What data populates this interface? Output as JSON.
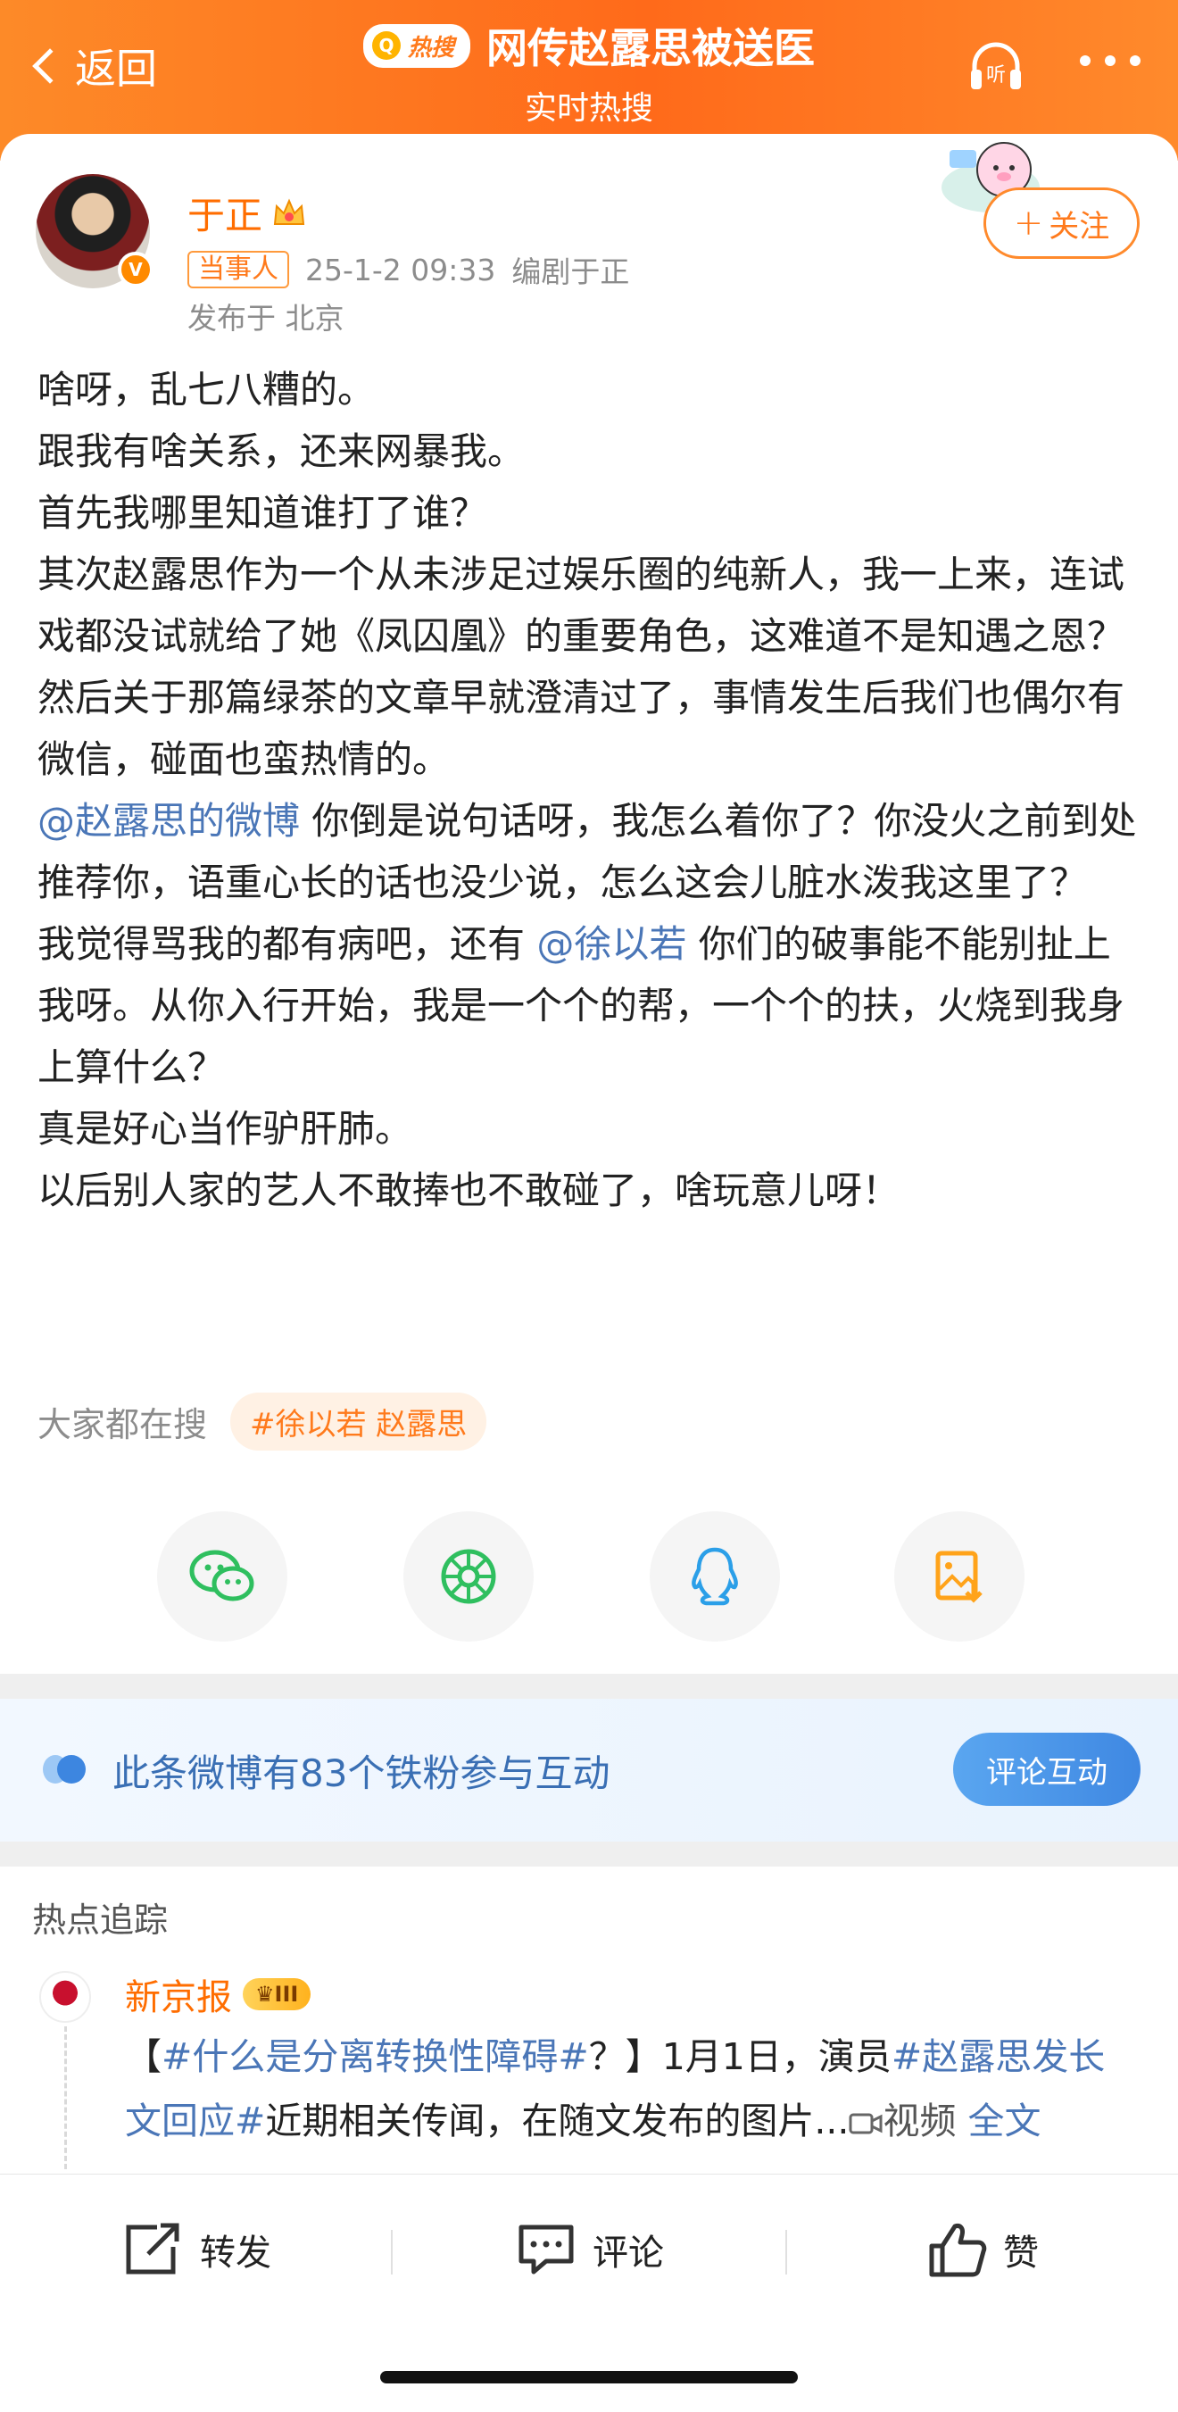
{
  "header": {
    "back_label": "返回",
    "hot_badge": "热搜",
    "title": "网传赵露思被送医",
    "subtitle": "实时热搜",
    "listen_label": "听",
    "bg_color": "#ff7a22"
  },
  "post": {
    "author": "于正",
    "role_tag": "当事人",
    "timestamp": "25-1-2 09:33",
    "author_desc": "编剧于正",
    "location": "发布于 北京",
    "follow_label": "关注",
    "lines": [
      "啥呀，乱七八糟的。",
      "跟我有啥关系，还来网暴我。",
      "首先我哪里知道谁打了谁？",
      "其次赵露思作为一个从未涉足过娱乐圈的纯新人，我一上来，连试戏都没试就给了她《凤囚凰》的重要角色，这难道不是知遇之恩？",
      "然后关于那篇绿茶的文章早就澄清过了，事情发生后我们也偶尔有微信，碰面也蛮热情的。"
    ],
    "mention1": "@赵露思的微博",
    "line_after_mention1": " 你倒是说句话呀，我怎么着你了？你没火之前到处推荐你，语重心长的话也没少说，怎么这会儿脏水泼我这里了？",
    "line_before_mention2": "我觉得骂我的都有病吧，还有 ",
    "mention2": "@徐以若",
    "line_after_mention2": " 你们的破事能不能别扯上我呀。从你入行开始，我是一个个的帮，一个个的扶，火烧到我身上算什么？",
    "closing_lines": [
      "真是好心当作驴肝肺。",
      "以后别人家的艺人不敢捧也不敢碰了，啥玩意儿呀！"
    ]
  },
  "search": {
    "label": "大家都在搜",
    "chip": "#徐以若 赵露思"
  },
  "share_icons": [
    "wechat-icon",
    "moments-icon",
    "qq-icon",
    "save-image-icon"
  ],
  "fans": {
    "text": "此条微博有83个铁粉参与互动",
    "button": "评论互动"
  },
  "trending": {
    "title": "热点追踪",
    "source": "新京报",
    "level": "III",
    "open_bracket": "【",
    "tag1": "#什么是分离转换性障碍#",
    "text1": "？】1月1日，演员",
    "tag2": "#赵露思发长文回应#",
    "text2": "近期相关传闻，在随文发布的图片...",
    "video_label": "视频",
    "full_label": "全文"
  },
  "bottom": {
    "repost": "转发",
    "comment": "评论",
    "like": "赞"
  }
}
